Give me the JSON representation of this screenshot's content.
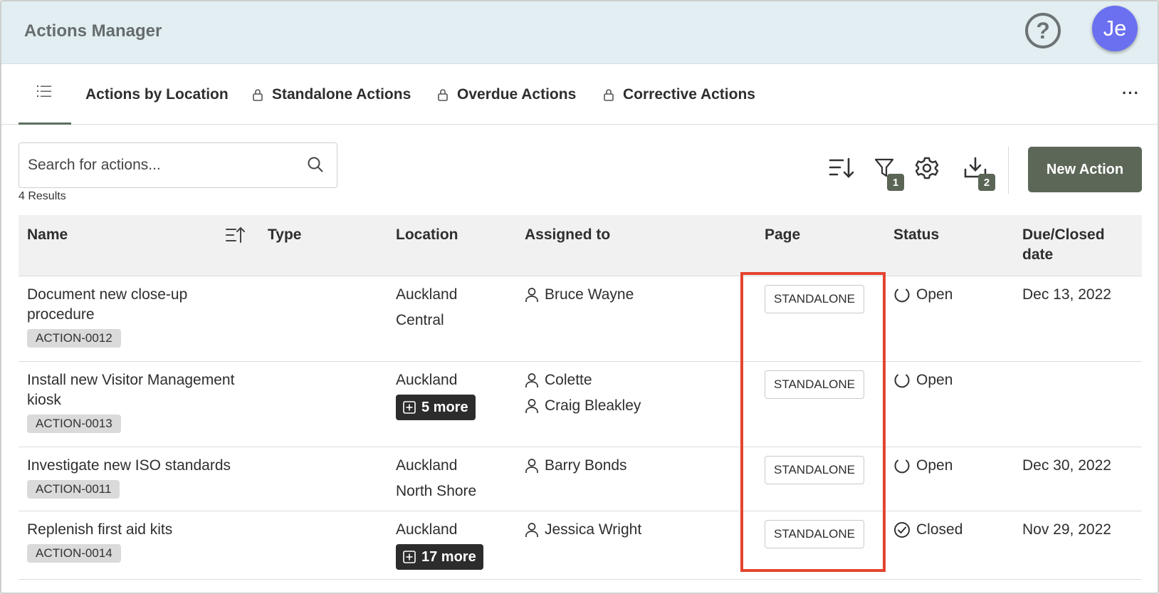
{
  "header": {
    "title": "Actions Manager",
    "help_icon": "help-circle-icon",
    "avatar_initials": "Je"
  },
  "tabs": [
    {
      "icon": "list-icon",
      "label": ""
    },
    {
      "label": "Actions by Location",
      "locked": false
    },
    {
      "label": "Standalone Actions",
      "locked": true
    },
    {
      "label": "Overdue Actions",
      "locked": true
    },
    {
      "label": "Corrective Actions",
      "locked": true
    }
  ],
  "tab_overflow_label": "···",
  "toolbar": {
    "search_placeholder": "Search for actions...",
    "search_value": "",
    "results_text": "4 Results",
    "filter_badge": "1",
    "download_badge": "2",
    "new_action_label": "New Action"
  },
  "table": {
    "columns": [
      "Name",
      "Type",
      "Location",
      "Assigned to",
      "Page",
      "Status",
      "Due/Closed date"
    ],
    "rows": [
      {
        "name": "Document new close-up procedure",
        "name_lines": [
          "Document new close-up",
          "procedure"
        ],
        "id": "ACTION-0012",
        "type": "",
        "location": [
          "Auckland",
          "Central"
        ],
        "location_more": "",
        "assigned": [
          "Bruce Wayne"
        ],
        "page": "STANDALONE",
        "status": "Open",
        "date": "Dec 13, 2022"
      },
      {
        "name": "Install new Visitor Management kiosk",
        "name_lines": [
          "Install new Visitor Management",
          "kiosk"
        ],
        "id": "ACTION-0013",
        "type": "",
        "location": [
          "Auckland"
        ],
        "location_more": "5 more",
        "assigned": [
          "Colette",
          "Craig Bleakley"
        ],
        "page": "STANDALONE",
        "status": "Open",
        "date": ""
      },
      {
        "name": "Investigate new ISO standards",
        "name_lines": [
          "Investigate new ISO standards"
        ],
        "id": "ACTION-0011",
        "type": "",
        "location": [
          "Auckland",
          "North Shore"
        ],
        "location_more": "",
        "assigned": [
          "Barry Bonds"
        ],
        "page": "STANDALONE",
        "status": "Open",
        "date": "Dec 30, 2022"
      },
      {
        "name": "Replenish first aid kits",
        "name_lines": [
          "Replenish first aid kits"
        ],
        "id": "ACTION-0014",
        "type": "",
        "location": [
          "Auckland"
        ],
        "location_more": "17 more",
        "assigned": [
          "Jessica Wright"
        ],
        "page": "STANDALONE",
        "status": "Closed",
        "date": "Nov 29, 2022"
      }
    ]
  },
  "colors": {
    "header_bg": "#e2eef1",
    "accent": "#5c6758",
    "avatar": "#6a70f0",
    "highlight": "#e4452f"
  }
}
